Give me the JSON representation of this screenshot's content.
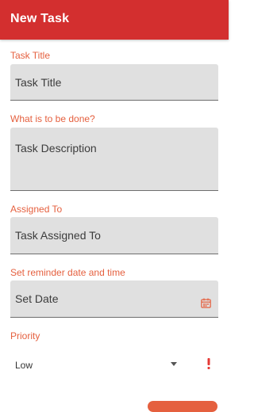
{
  "appbar": {
    "title": "New Task"
  },
  "form": {
    "title_field": {
      "label": "Task Title",
      "placeholder": "Task Title",
      "value": ""
    },
    "description_field": {
      "label": "What is to be done?",
      "placeholder": "Task Description",
      "value": ""
    },
    "assigned_field": {
      "label": "Assigned To",
      "placeholder": "Task Assigned To",
      "value": ""
    },
    "reminder_field": {
      "label": "Set reminder date and time",
      "placeholder": "Set Date",
      "value": "",
      "icon": "calendar-icon"
    },
    "priority": {
      "label": "Priority",
      "selected": "Low",
      "icon": "exclamation-icon"
    }
  },
  "colors": {
    "appbar": "#d32f2f",
    "accent": "#e5603f",
    "field_bg": "#e0e0e0"
  }
}
